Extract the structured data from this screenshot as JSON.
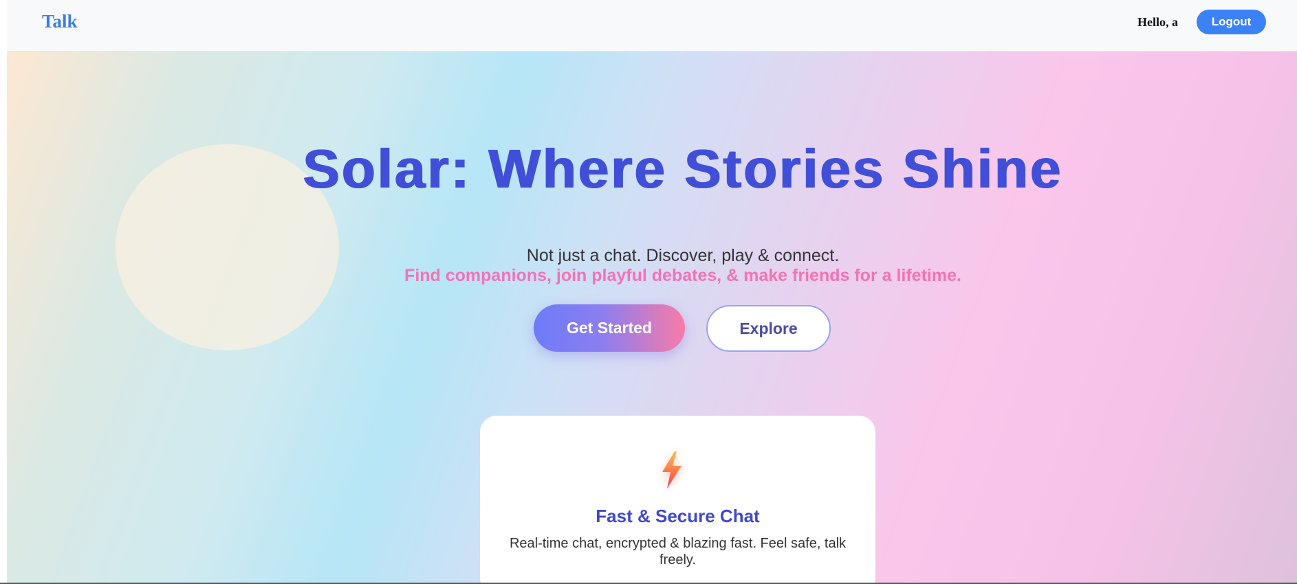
{
  "navbar": {
    "brand": "Talk",
    "greeting": "Hello, a",
    "logout_label": "Logout"
  },
  "hero": {
    "title": "Solar: Where Stories Shine",
    "subtitle": "Not just a chat. Discover, play & connect.",
    "tagline": "Find companions, join playful debates, & make friends for a lifetime.",
    "primary_button": "Get Started",
    "secondary_button": "Explore"
  },
  "feature_card": {
    "icon": "lightning-bolt-icon",
    "title": "Fast & Secure Chat",
    "description": "Real-time chat, encrypted & blazing fast. Feel safe, talk freely."
  },
  "colors": {
    "brand_blue": "#3f7de0",
    "logout_blue": "#3b82f6",
    "title_indigo": "#414fd8",
    "tagline_pink": "#f472b6"
  }
}
